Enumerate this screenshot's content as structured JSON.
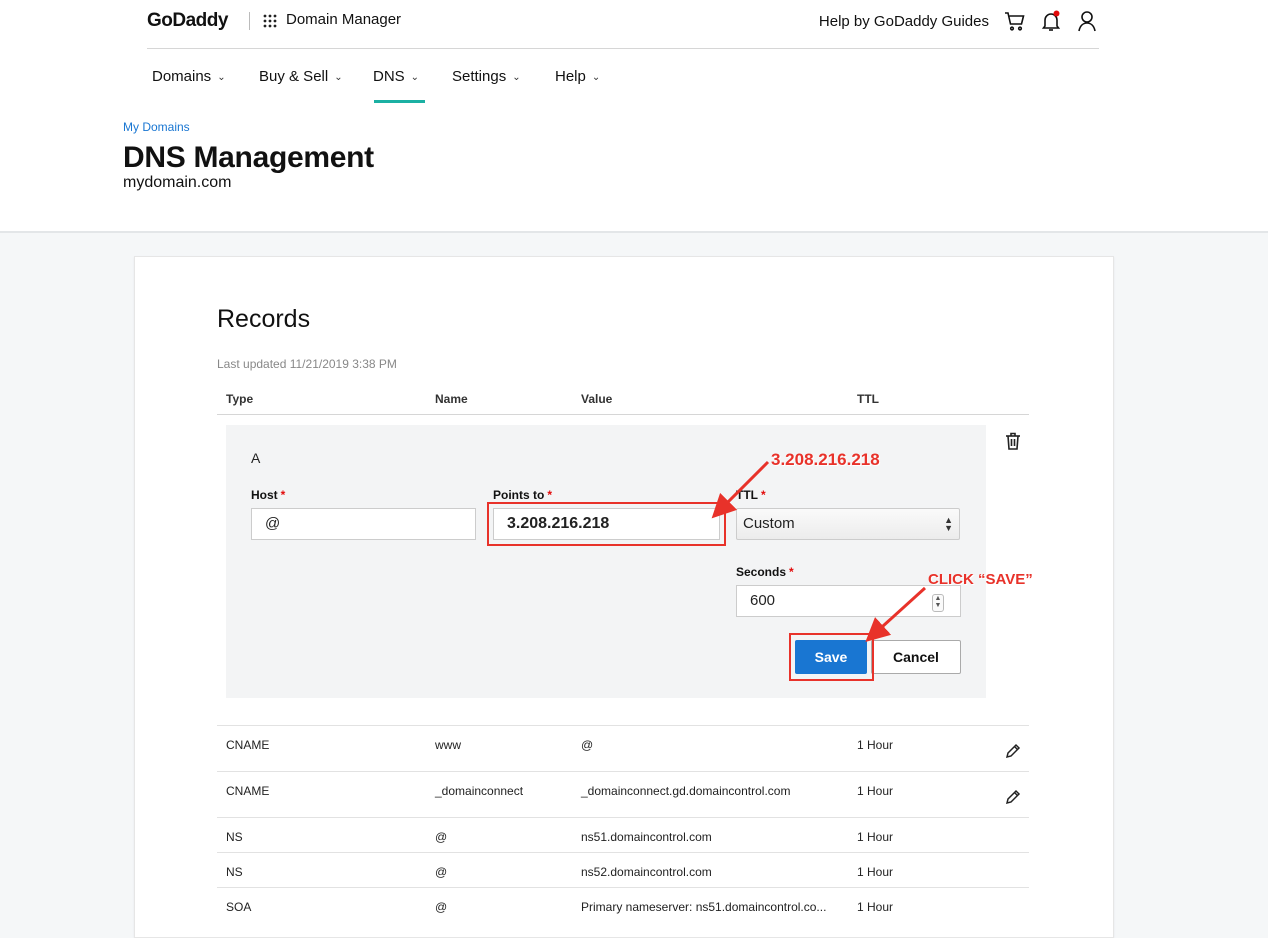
{
  "header": {
    "logo": "GoDaddy",
    "product": "Domain Manager",
    "help_link": "Help by GoDaddy Guides"
  },
  "nav": {
    "items": [
      {
        "label": "Domains"
      },
      {
        "label": "Buy & Sell"
      },
      {
        "label": "DNS"
      },
      {
        "label": "Settings"
      },
      {
        "label": "Help"
      }
    ],
    "active": "DNS",
    "accent_color": "#1bb0a3"
  },
  "page": {
    "breadcrumb": "My Domains",
    "title": "DNS Management",
    "domain": "mydomain.com"
  },
  "records": {
    "title": "Records",
    "last_updated": "Last updated 11/21/2019 3:38 PM",
    "columns": [
      "Type",
      "Name",
      "Value",
      "TTL"
    ],
    "editor": {
      "type": "A",
      "host_label": "Host",
      "host_value": "@",
      "points_to_label": "Points to",
      "points_to_value": "3.208.216.218",
      "ttl_label": "TTL",
      "ttl_value": "Custom",
      "seconds_label": "Seconds",
      "seconds_value": "600",
      "required_mark": "*",
      "save_label": "Save",
      "cancel_label": "Cancel"
    },
    "rows": [
      {
        "type": "CNAME",
        "name": "www",
        "value": "@",
        "ttl": "1 Hour",
        "editable": true
      },
      {
        "type": "CNAME",
        "name": "_domainconnect",
        "value": "_domainconnect.gd.domaincontrol.com",
        "ttl": "1 Hour",
        "editable": true
      },
      {
        "type": "NS",
        "name": "@",
        "value": "ns51.domaincontrol.com",
        "ttl": "1 Hour",
        "editable": false
      },
      {
        "type": "NS",
        "name": "@",
        "value": "ns52.domaincontrol.com",
        "ttl": "1 Hour",
        "editable": false
      },
      {
        "type": "SOA",
        "name": "@",
        "value": "Primary nameserver: ns51.domaincontrol.co...",
        "ttl": "1 Hour",
        "editable": false
      }
    ]
  },
  "annotations": {
    "ip_callout": "3.208.216.218",
    "save_callout": "CLICK “SAVE”",
    "color": "#e8322a"
  },
  "colors": {
    "primary_button": "#1976d2",
    "link": "#1976d2",
    "required": "#e20b0b"
  }
}
